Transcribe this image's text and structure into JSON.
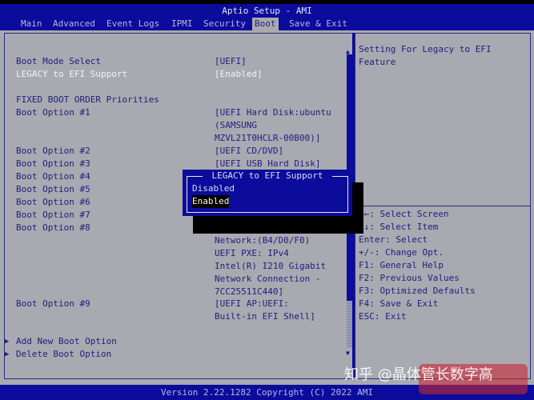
{
  "header": {
    "title": "Aptio Setup - AMI",
    "tabs": [
      {
        "label": "Main"
      },
      {
        "label": "Advanced"
      },
      {
        "label": "Event Logs"
      },
      {
        "label": "IPMI"
      },
      {
        "label": "Security"
      },
      {
        "label": "Boot",
        "active": true
      },
      {
        "label": "Save & Exit"
      }
    ]
  },
  "main": {
    "items": [
      {
        "label": "Boot Mode Select",
        "value": "[UEFI]"
      },
      {
        "label": "LEGACY to EFI Support",
        "value": "[Enabled]"
      },
      {
        "label": "FIXED BOOT ORDER Priorities"
      },
      {
        "label": "Boot Option #1",
        "value": [
          "[UEFI Hard Disk:ubuntu",
          "(SAMSUNG",
          "MZVL21T0HCLR-00B00)]"
        ]
      },
      {
        "label": "Boot Option #2",
        "value": "[UEFI CD/DVD]"
      },
      {
        "label": "Boot Option #3",
        "value": "[UEFI USB Hard Disk]"
      },
      {
        "label": "Boot Option #4"
      },
      {
        "label": "Boot Option #5"
      },
      {
        "label": "Boot Option #6"
      },
      {
        "label": "Boot Option #7"
      },
      {
        "label": "Boot Option #8",
        "value": [
          "Network:(B4/D0/F0)",
          "UEFI PXE: IPv4",
          "Intel(R) I210 Gigabit",
          "Network Connection -",
          "7CC25511C440]"
        ]
      },
      {
        "label": "Boot Option #9",
        "value": [
          "[UEFI AP:UEFI:",
          "Built-in EFI Shell]"
        ]
      },
      {
        "label": "Add New Boot Option"
      },
      {
        "label": "Delete Boot Option"
      }
    ]
  },
  "popup": {
    "title": "LEGACY to EFI Support",
    "options": [
      "Disabled",
      "Enabled"
    ],
    "selected": "Enabled"
  },
  "help": {
    "text": [
      "Setting For Legacy to EFI",
      "Feature"
    ],
    "keys": [
      "→←: Select Screen",
      "↑↓: Select Item",
      "Enter: Select",
      "+/-: Change Opt.",
      "F1: General Help",
      "F2: Previous Values",
      "F3: Optimized Defaults",
      "F4: Save & Exit",
      "ESC: Exit"
    ]
  },
  "footer": {
    "text": "Version 2.22.1282 Copyright (C) 2022 AMI"
  },
  "watermark": "知乎 @晶体管长数字高",
  "colors": {
    "blue": "#0b0b9c",
    "gray": "#a9a9b1",
    "text": "#20207e"
  }
}
